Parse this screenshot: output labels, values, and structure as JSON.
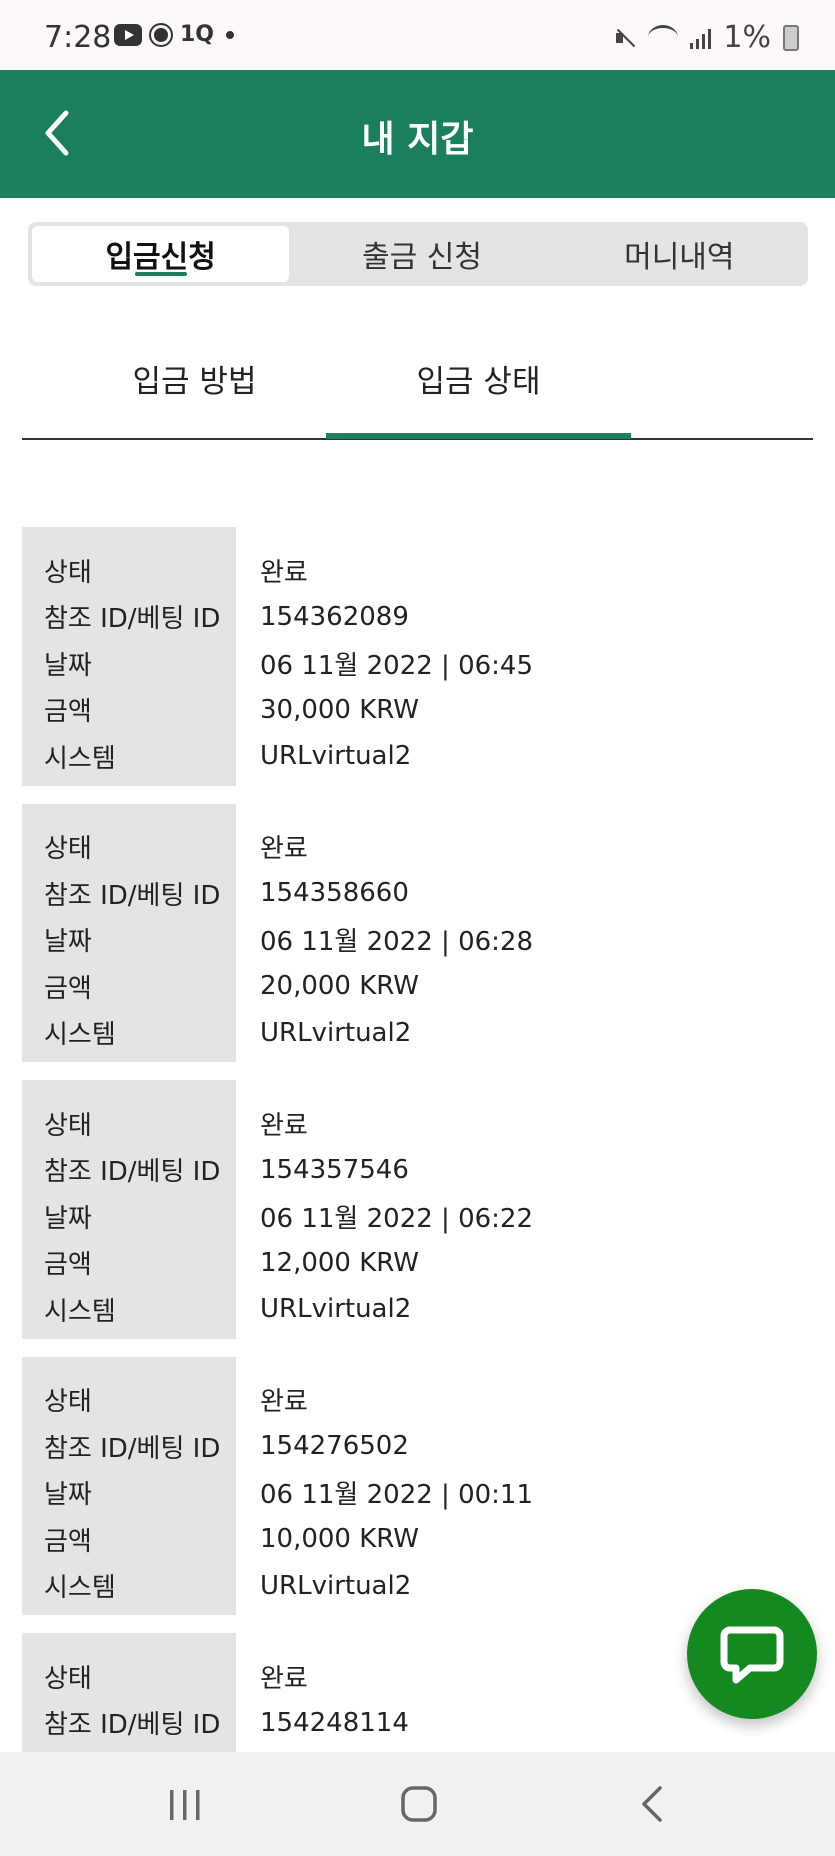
{
  "status_bar": {
    "time": "7:28",
    "battery": "1%",
    "icons": [
      "youtube-icon",
      "brightness-icon",
      "1q-icon",
      "dot-icon",
      "mute-icon",
      "wifi-icon",
      "signal-icon",
      "battery-icon"
    ]
  },
  "header": {
    "title": "내 지갑",
    "back_icon": "chevron-left-icon",
    "background": "#1a7f5f"
  },
  "segment_tabs": [
    {
      "label": "입금신청",
      "active": true
    },
    {
      "label": "출금 신청",
      "active": false
    },
    {
      "label": "머니내역",
      "active": false
    }
  ],
  "sub_tabs": [
    {
      "label": "입금 방법",
      "active": false
    },
    {
      "label": "입금 상태",
      "active": true
    }
  ],
  "labels": {
    "status": "상태",
    "ref_id": "참조 ID/베팅 ID",
    "date": "날짜",
    "amount": "금액",
    "system": "시스템"
  },
  "records": [
    {
      "status": "완료",
      "ref_id": "154362089",
      "date": "06 11월 2022 | 06:45",
      "amount": "30,000 KRW",
      "system": "URLvirtual2"
    },
    {
      "status": "완료",
      "ref_id": "154358660",
      "date": "06 11월 2022 | 06:28",
      "amount": "20,000 KRW",
      "system": "URLvirtual2"
    },
    {
      "status": "완료",
      "ref_id": "154357546",
      "date": "06 11월 2022 | 06:22",
      "amount": "12,000 KRW",
      "system": "URLvirtual2"
    },
    {
      "status": "완료",
      "ref_id": "154276502",
      "date": "06 11월 2022 | 00:11",
      "amount": "10,000 KRW",
      "system": "URLvirtual2"
    },
    {
      "status": "완료",
      "ref_id": "154248114"
    }
  ],
  "chat_button": {
    "icon": "chat-bubble-icon",
    "color": "#13891f"
  },
  "nav_bar": {
    "icons": [
      "recent-apps-icon",
      "home-icon",
      "back-icon"
    ]
  }
}
